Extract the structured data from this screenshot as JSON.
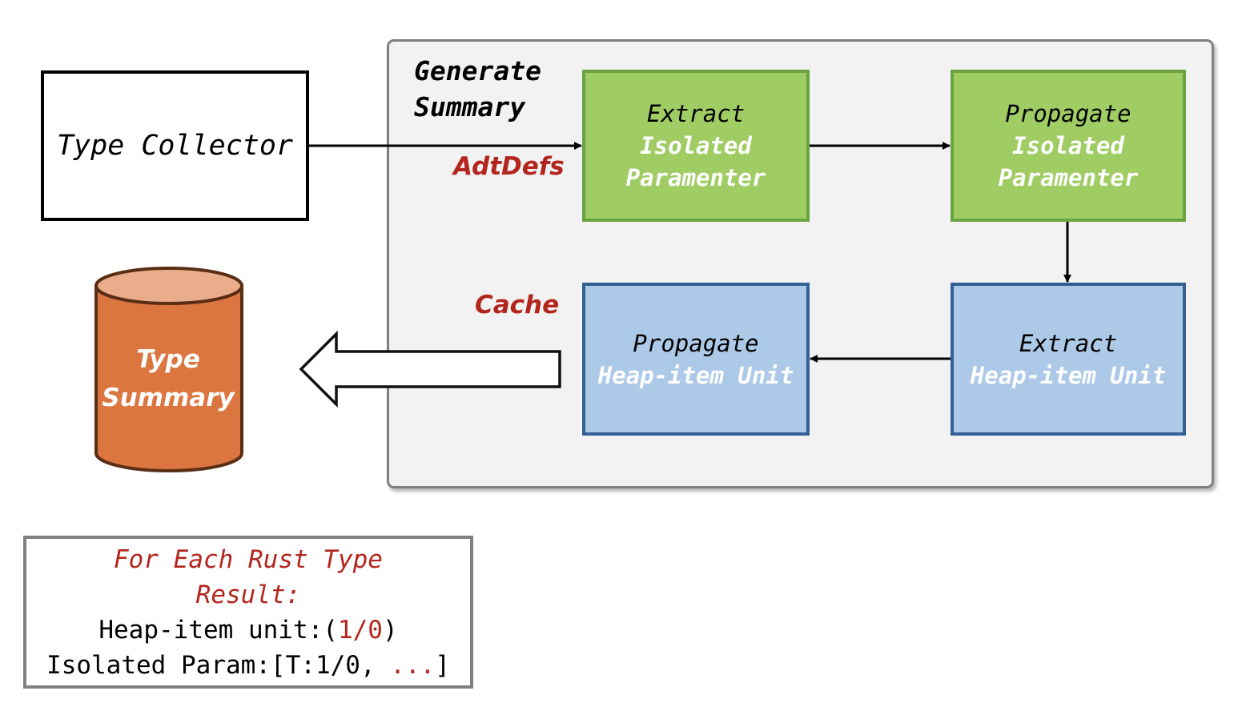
{
  "nodes": {
    "type_collector": {
      "label": "Type Collector"
    },
    "group": {
      "title_line1": "Generate",
      "title_line2": "Summary"
    },
    "extract_isolated": {
      "line1": "Extract",
      "line2": "Isolated",
      "line3": "Paramenter"
    },
    "propagate_isolated": {
      "line1": "Propagate",
      "line2": "Isolated",
      "line3": "Paramenter"
    },
    "extract_heap": {
      "line1": "Extract",
      "line2": "Heap-item Unit"
    },
    "propagate_heap": {
      "line1": "Propagate",
      "line2": "Heap-item Unit"
    },
    "type_summary": {
      "line1": "Type",
      "line2": "Summary"
    }
  },
  "edge_labels": {
    "adtdefs": "AdtDefs",
    "cache": "Cache"
  },
  "result_box": {
    "line1": "For Each Rust Type",
    "line2": "Result:",
    "heap_prefix": "Heap-item unit:(",
    "heap_value": "1/0",
    "heap_suffix": ")",
    "param_prefix": "Isolated Param:[T:1/0, ",
    "param_ellipsis": "...",
    "param_suffix": "]"
  },
  "colors": {
    "green_fill": "#a0cc64",
    "green_border": "#6aa342",
    "blue_fill": "#adc9e8",
    "blue_border": "#335f95",
    "cylinder_fill": "#dc7641",
    "cylinder_top": "#e9ad8b",
    "cylinder_border": "#5a2e14",
    "accent_red": "#b3261e",
    "group_fill": "#f2f2f2"
  }
}
